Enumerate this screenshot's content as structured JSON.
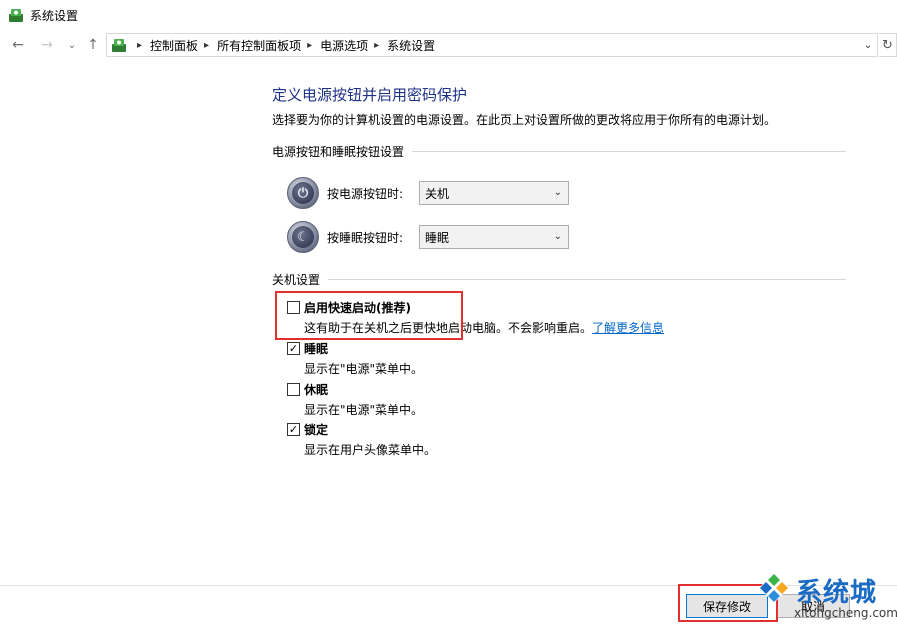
{
  "window": {
    "title": "系统设置"
  },
  "nav": {
    "back_icon": "arrow-left-icon",
    "forward_icon": "arrow-right-icon",
    "recent_icon": "chevron-down-icon",
    "up_icon": "arrow-up-icon",
    "breadcrumbs": [
      "控制面板",
      "所有控制面板项",
      "电源选项",
      "系统设置"
    ],
    "refresh_icon": "refresh-icon"
  },
  "main": {
    "title": "定义电源按钮并启用密码保护",
    "description": "选择要为你的计算机设置的电源设置。在此页上对设置所做的更改将应用于你所有的电源计划。",
    "buttons_section": {
      "header": "电源按钮和睡眠按钮设置",
      "power_button": {
        "label": "按电源按钮时:",
        "value": "关机"
      },
      "sleep_button": {
        "label": "按睡眠按钮时:",
        "value": "睡眠"
      }
    },
    "shutdown_section": {
      "header": "关机设置",
      "options": [
        {
          "name": "启用快速启动(推荐)",
          "desc": "这有助于在关机之后更快地启动电脑。不会影响重启。",
          "link": "了解更多信息",
          "checked": false
        },
        {
          "name": "睡眠",
          "desc": "显示在\"电源\"菜单中。",
          "checked": true
        },
        {
          "name": "休眠",
          "desc": "显示在\"电源\"菜单中。",
          "checked": false
        },
        {
          "name": "锁定",
          "desc": "显示在用户头像菜单中。",
          "checked": true
        }
      ]
    }
  },
  "footer": {
    "save_label": "保存修改",
    "cancel_label": "取消"
  },
  "watermark": {
    "text_cn": "系统城",
    "text_en": "xitongcheng.com"
  },
  "colors": {
    "title_blue": "#1e3287",
    "link_blue": "#0066cc",
    "highlight_red": "#e03030"
  }
}
